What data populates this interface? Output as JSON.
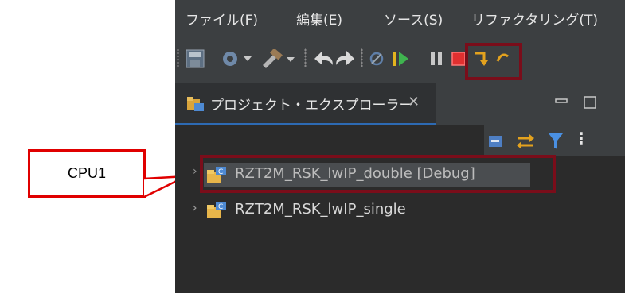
{
  "menu": {
    "items": [
      "ファイル(F)",
      "編集(E)",
      "ソース(S)",
      "リファクタリング(T)"
    ]
  },
  "toolbar": {
    "icons": [
      "save-icon",
      "build-config-icon",
      "hammer-build-icon",
      "back-icon",
      "forward-icon",
      "skip-breakpoints-icon",
      "resume-icon",
      "suspend-icon",
      "terminate-icon",
      "step-into-icon"
    ]
  },
  "project_explorer": {
    "tab_title": "プロジェクト・エクスプローラー",
    "close_glyph": "✕",
    "projects": [
      {
        "name": "RZT2M_RSK_lwIP_double [Debug]",
        "selected": true
      },
      {
        "name": "RZT2M_RSK_lwIP_single",
        "selected": false
      }
    ]
  },
  "annotation": {
    "callout_text": "CPU1",
    "callout_color": "#e00000",
    "highlight_color": "#7a0d1a"
  }
}
